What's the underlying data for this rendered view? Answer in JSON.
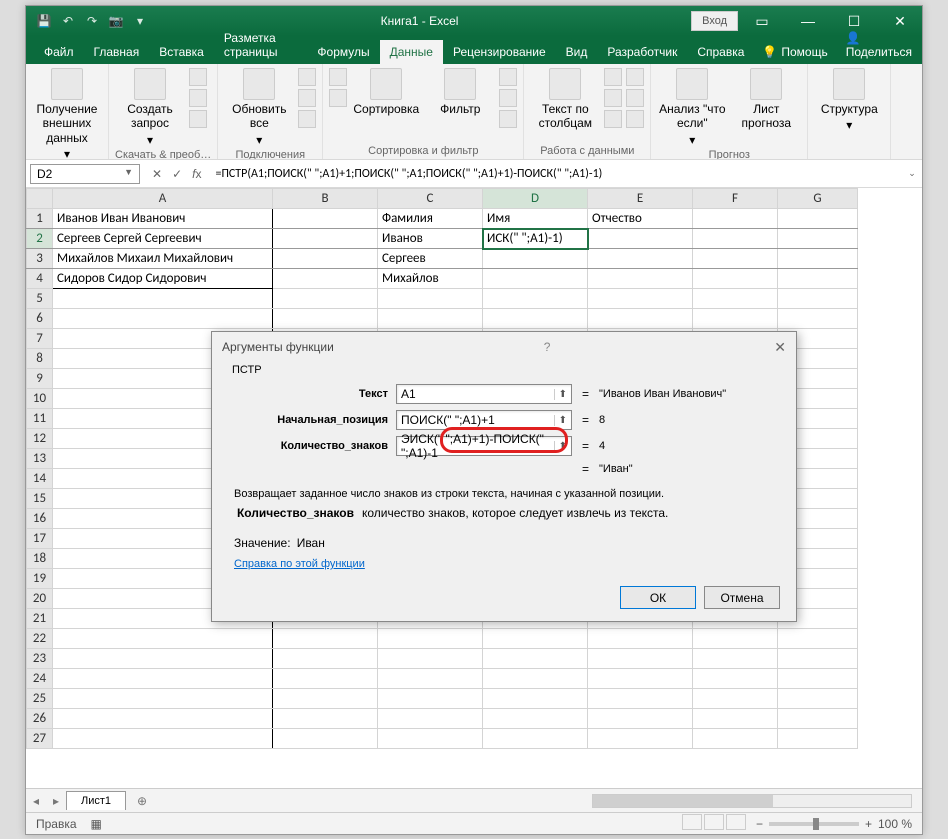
{
  "title": "Книга1  -  Excel",
  "signin": "Вход",
  "ribbon_tabs": [
    "Файл",
    "Главная",
    "Вставка",
    "Разметка страницы",
    "Формулы",
    "Данные",
    "Рецензирование",
    "Вид",
    "Разработчик",
    "Справка"
  ],
  "active_tab": "Данные",
  "tell_me": "Помощь",
  "share": "Поделиться",
  "ribbon_groups": {
    "g1": {
      "btn": "Получение внешних данных",
      "caption": ""
    },
    "g2": {
      "btn": "Создать запрос",
      "caption": "Скачать & преоб…"
    },
    "g3": {
      "btn": "Обновить все",
      "caption": "Подключения"
    },
    "g4": {
      "b1": "Сортировка",
      "b2": "Фильтр",
      "caption": "Сортировка и фильтр"
    },
    "g5": {
      "btn": "Текст по столбцам",
      "caption": "Работа с данными"
    },
    "g6": {
      "b1": "Анализ \"что если\"",
      "b2": "Лист прогноза",
      "caption": "Прогноз"
    },
    "g7": {
      "btn": "Структура",
      "caption": ""
    }
  },
  "namebox": "D2",
  "formula": "=ПСТР(A1;ПОИСК(\" \";A1)+1;ПОИСК(\" \";A1;ПОИСК(\" \";A1)+1)-ПОИСК(\" \";A1)-1)",
  "columns": [
    "A",
    "B",
    "C",
    "D",
    "E",
    "F",
    "G"
  ],
  "rows": {
    "1": {
      "A": "Иванов Иван Иванович",
      "C": "Фамилия",
      "D": "Имя",
      "E": "Отчество"
    },
    "2": {
      "A": "Сергеев Сергей Сергеевич",
      "C": "Иванов",
      "D": "ИСК(\" \";A1)-1)"
    },
    "3": {
      "A": "Михайлов Михаил Михайлович",
      "C": "Сергеев"
    },
    "4": {
      "A": "Сидоров Сидор Сидорович",
      "C": "Михайлов"
    }
  },
  "dialog": {
    "title": "Аргументы функции",
    "func": "ПСТР",
    "args": {
      "a1": {
        "label": "Текст",
        "val": "A1",
        "res": "\"Иванов Иван Иванович\""
      },
      "a2": {
        "label": "Начальная_позиция",
        "val": "ПОИСК(\" \";A1)+1",
        "res": "8"
      },
      "a3": {
        "label": "Количество_знаков",
        "val": "ЭИСК(\" \";A1)+1)-ПОИСК(\" \";A1)-1",
        "res": "4"
      }
    },
    "preview": "\"Иван\"",
    "desc": "Возвращает заданное число знаков из строки текста, начиная с указанной позиции.",
    "arg_desc_label": "Количество_знаков",
    "arg_desc": "количество знаков, которое следует извлечь из текста.",
    "result_label": "Значение:",
    "result": "Иван",
    "help_link": "Справка по этой функции",
    "ok": "ОК",
    "cancel": "Отмена"
  },
  "sheet_tab": "Лист1",
  "status_left": "Правка",
  "zoom": "100 %"
}
